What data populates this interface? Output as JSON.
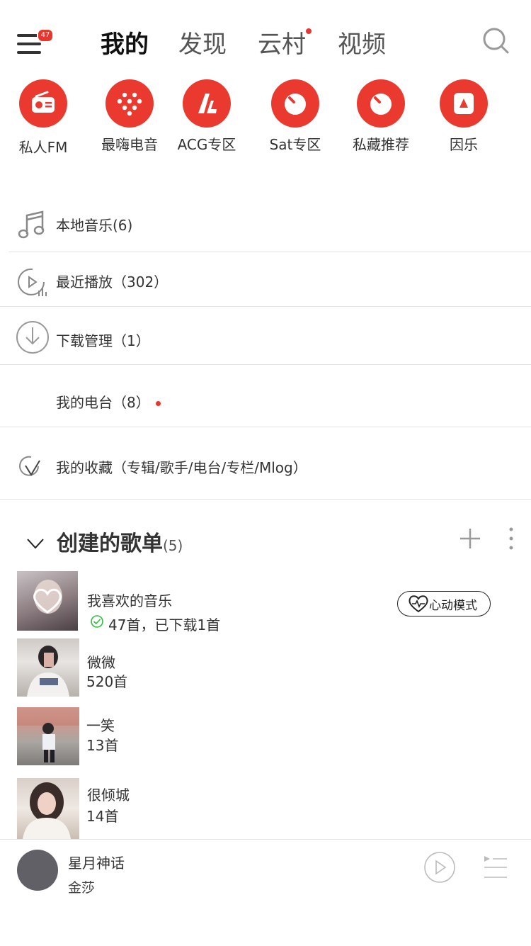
{
  "header": {
    "menu_badge": "47",
    "tabs": [
      {
        "label": "我的"
      },
      {
        "label": "发现"
      },
      {
        "label": "云村"
      },
      {
        "label": "视频"
      }
    ]
  },
  "quick_entries": [
    {
      "label": "私人FM",
      "icon": "radio-icon"
    },
    {
      "label": "最嗨电音",
      "icon": "dots-icon"
    },
    {
      "label": "ACG专区",
      "icon": "acg-icon"
    },
    {
      "label": "Sat专区",
      "icon": "sat-icon"
    },
    {
      "label": "私藏推荐",
      "icon": "sat-icon"
    },
    {
      "label": "因乐",
      "icon": "yinyue-icon"
    }
  ],
  "menu_list": [
    {
      "label": "本地音乐(6)",
      "icon": "music-note-icon"
    },
    {
      "label": "最近播放（302）",
      "icon": "recent-play-icon"
    },
    {
      "label": "下载管理（1）",
      "icon": "download-icon"
    },
    {
      "label": "我的电台（8）",
      "icon": "radio-station-icon"
    },
    {
      "label": "我的收藏（专辑/歌手/电台/专栏/Mlog）",
      "icon": "collection-icon"
    }
  ],
  "playlists_section": {
    "title": "创建的歌单",
    "count": "(5)"
  },
  "playlists": [
    {
      "name": "我喜欢的音乐",
      "sub": "47首，已下载1首",
      "heart_mode_label": "心动模式"
    },
    {
      "name": "微微",
      "sub": "520首"
    },
    {
      "name": "一笑",
      "sub": "13首"
    },
    {
      "name": "很倾城",
      "sub": "14首"
    }
  ],
  "player": {
    "song": "星月神话",
    "artist": "金莎"
  },
  "colors": {
    "accent": "#ea3a30",
    "text": "#333333",
    "separator": "#e2e2e2"
  }
}
